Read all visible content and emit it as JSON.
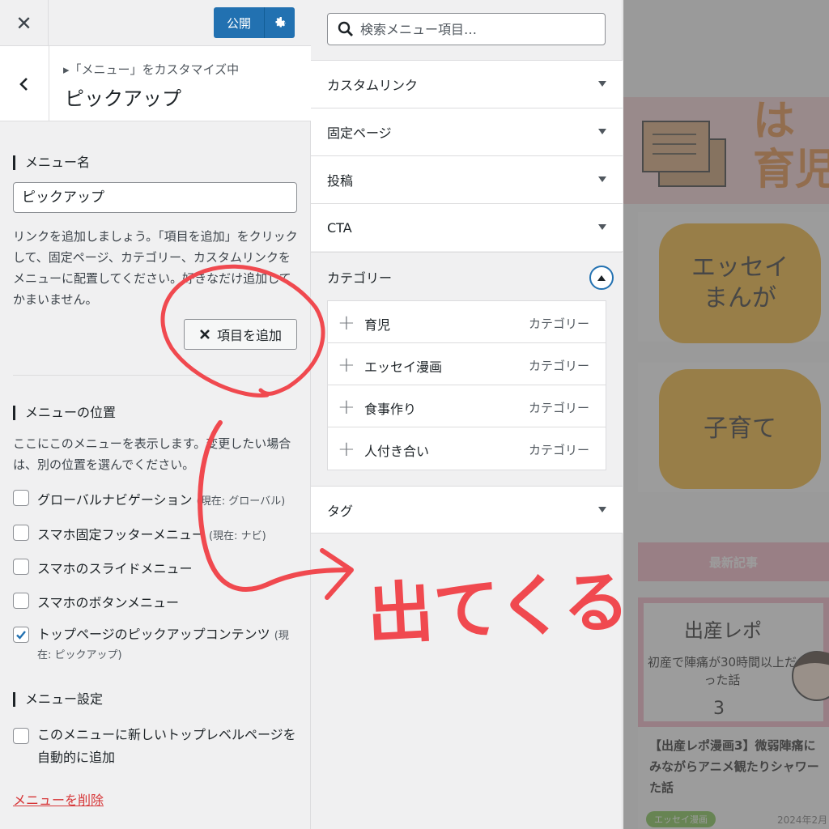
{
  "topbar": {
    "publish_label": "公開"
  },
  "section": {
    "breadcrumb": "▸「メニュー」をカスタマイズ中",
    "title": "ピックアップ"
  },
  "menu_name": {
    "label": "メニュー名",
    "value": "ピックアップ"
  },
  "help_text": "リンクを追加しましょう。「項目を追加」をクリックして、固定ページ、カテゴリー、カスタムリンクをメニューに配置してください。好きなだけ追加してかまいません。",
  "add_item_label": "項目を追加",
  "locations": {
    "label": "メニューの位置",
    "desc": "ここにこのメニューを表示します。変更したい場合は、別の位置を選んでください。",
    "items": [
      {
        "text": "グローバルナビゲーション",
        "note": "(現在: グローバル)",
        "checked": false
      },
      {
        "text": "スマホ固定フッターメニュー",
        "note": "(現在: ナビ)",
        "checked": false
      },
      {
        "text": "スマホのスライドメニュー",
        "note": "",
        "checked": false
      },
      {
        "text": "スマホのボタンメニュー",
        "note": "",
        "checked": false
      },
      {
        "text": "トップページのピックアップコンテンツ",
        "note": "(現在: ピックアップ)",
        "checked": true
      }
    ]
  },
  "settings": {
    "label": "メニュー設定",
    "auto_add": "このメニューに新しいトップレベルページを自動的に追加"
  },
  "delete_label": "メニューを削除",
  "search": {
    "placeholder": "検索メニュー項目…"
  },
  "accordion": {
    "custom_link": "カスタムリンク",
    "pages": "固定ページ",
    "posts": "投稿",
    "cta": "CTA",
    "categories": "カテゴリー",
    "tags": "タグ"
  },
  "categories": [
    {
      "name": "育児",
      "type": "カテゴリー"
    },
    {
      "name": "エッセイ漫画",
      "type": "カテゴリー"
    },
    {
      "name": "食事作り",
      "type": "カテゴリー"
    },
    {
      "name": "人付き合い",
      "type": "カテゴリー"
    }
  ],
  "preview": {
    "hero_text": "は\n育児",
    "card1": "エッセイ\nまんが",
    "card2": "子育て",
    "recent_label": "最新記事",
    "thumb_title": "出産レポ",
    "thumb_sub": "初産で陣痛が30時間以上だった話",
    "thumb_num": "3",
    "post_title": "【出産レポ漫画3】微弱陣痛に\nみながらアニメ観たりシャワー\nた話",
    "post_tag": "エッセイ漫画",
    "post_date": "2024年2月"
  },
  "annotation_text": "出てくる",
  "colors": {
    "accent": "#2271b1",
    "annotation": "#f0494f",
    "danger": "#d63638"
  }
}
